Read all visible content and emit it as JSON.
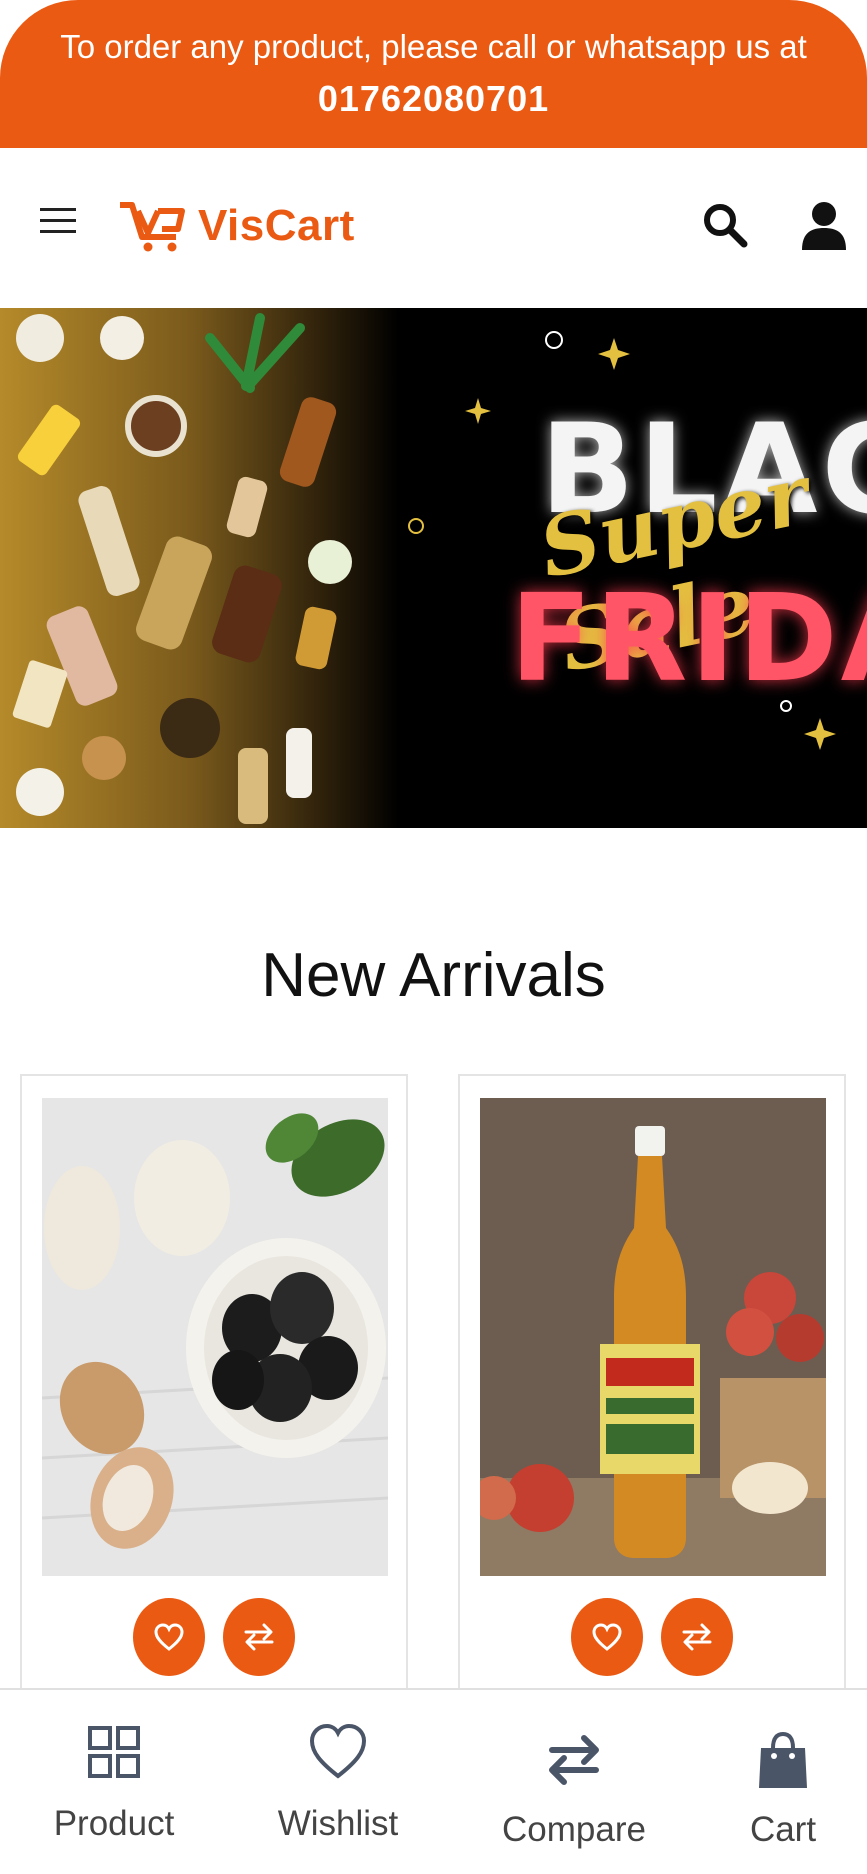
{
  "announcement": {
    "line1": "To order any product, please call or whatsapp us at",
    "phone": "01762080701"
  },
  "header": {
    "brand": "VisCart",
    "icons": [
      "menu-icon",
      "search-icon",
      "user-icon"
    ]
  },
  "banner": {
    "word1": "BLACK",
    "word2": "Super Sale",
    "word3": "FRIDAY"
  },
  "new_arrivals": {
    "title": "New Arrivals",
    "products": [
      {
        "image": "black-garlic-photo",
        "actions": [
          "heart-icon",
          "compare-icon"
        ]
      },
      {
        "image": "apple-cider-vinegar-photo",
        "actions": [
          "heart-icon",
          "compare-icon"
        ]
      }
    ]
  },
  "bottom_nav": {
    "items": [
      {
        "label": "Product",
        "icon": "grid-icon"
      },
      {
        "label": "Wishlist",
        "icon": "heart-icon"
      },
      {
        "label": "Compare",
        "icon": "compare-icon"
      },
      {
        "label": "Cart",
        "icon": "bag-icon"
      }
    ]
  },
  "colors": {
    "accent": "#ea5a12",
    "nav_icon": "#4a5568"
  }
}
